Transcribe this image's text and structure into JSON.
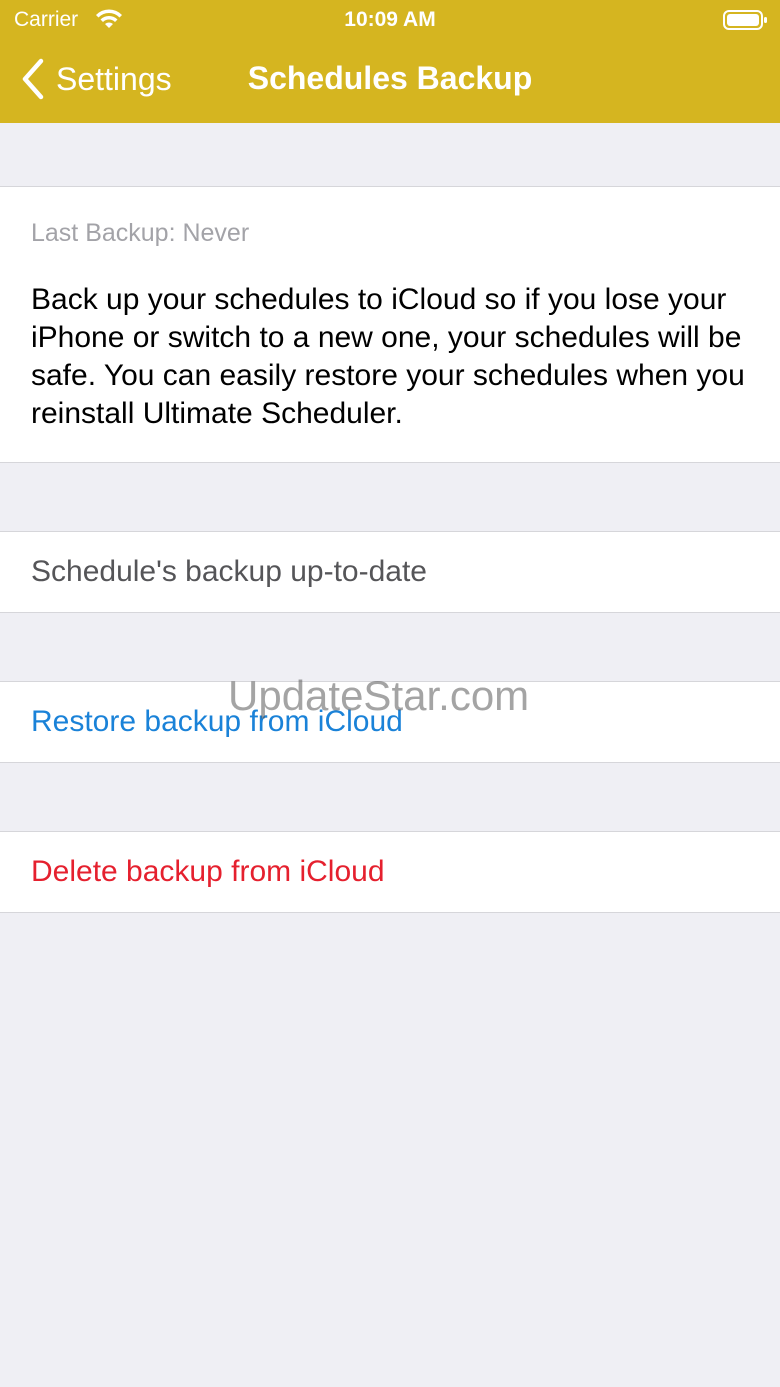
{
  "status_bar": {
    "carrier": "Carrier",
    "time": "10:09 AM",
    "wifi_icon": "wifi-icon",
    "battery_icon": "battery-icon"
  },
  "nav": {
    "back_label": "Settings",
    "back_icon": "chevron-left-icon",
    "title": "Schedules Backup",
    "bar_color": "#d5b520"
  },
  "info": {
    "last_backup": "Last Backup: Never",
    "description": "Back up your schedules to iCloud so if you lose your iPhone or switch to a new one, your schedules will be safe. You can easily restore your schedules when you reinstall Ultimate Scheduler."
  },
  "status": {
    "text": "Schedule's backup up-to-date"
  },
  "actions": {
    "restore_label": "Restore backup from iCloud",
    "restore_color": "#1a82d8",
    "delete_label": "Delete backup from iCloud",
    "delete_color": "#e5202e"
  },
  "watermark": "UpdateStar.com"
}
